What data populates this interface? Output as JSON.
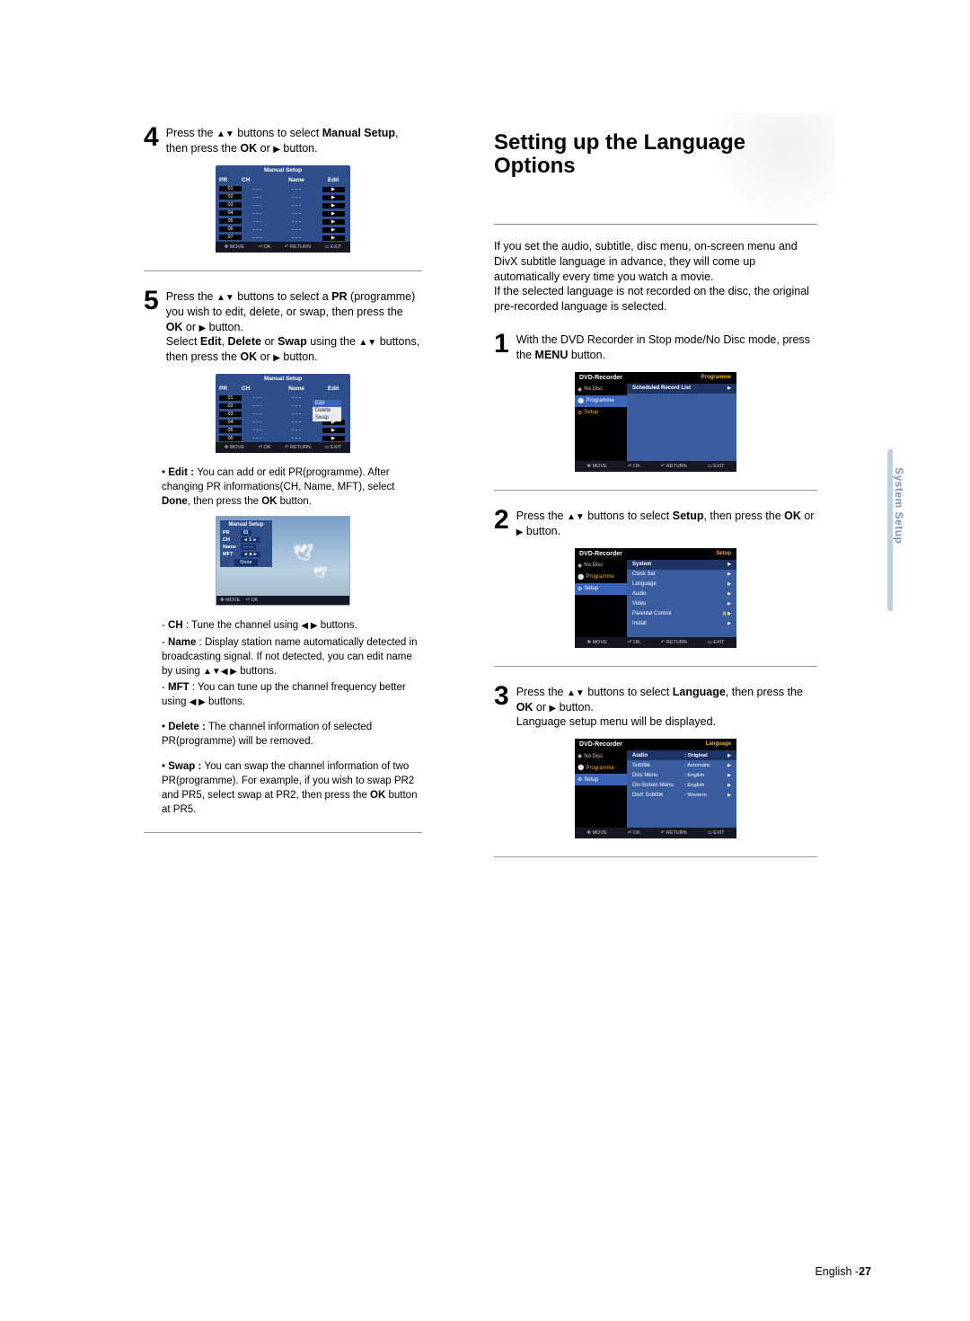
{
  "left": {
    "step4": {
      "num": "4",
      "text_a": "Press the ",
      "text_b": " buttons to select ",
      "bold_b": "Manual Setup",
      "text_c": ", then press the ",
      "bold_c": "OK",
      "text_d": " or ",
      "text_e": " button."
    },
    "osd1": {
      "title": "Manual Setup",
      "h1": "PR",
      "h2": "CH",
      "h3": "Name",
      "h4": "Edit",
      "rows": [
        "01",
        "02",
        "03",
        "04",
        "05",
        "06",
        "07"
      ],
      "cell_blank": "- - -",
      "ft_move": "MOVE",
      "ft_ok": "OK",
      "ft_return": "RETURN",
      "ft_exit": "EXIT"
    },
    "step5": {
      "num": "5",
      "l1a": "Press the ",
      "l1b": " buttons to select a ",
      "l1bold": "PR",
      "l2": "(programme) you wish to edit, delete, or swap, then press the ",
      "l2bold": "OK",
      "l2b": " or ",
      "l2c": " button.",
      "l3a": "Select ",
      "l3bold1": "Edit",
      "l3c": ", ",
      "l3bold2": "Delete",
      "l3d": " or ",
      "l3bold3": "Swap",
      "l3e": " using the ",
      "l4a": "buttons, then press the ",
      "l4bold": "OK",
      "l4b": " or ",
      "l4c": " button."
    },
    "osd2": {
      "title": "Manual Setup",
      "popup_edit": "Edit",
      "popup_delete": "Delete",
      "popup_swap": "Swap"
    },
    "edit_block": {
      "b": "Edit : ",
      "t": "You can add or edit PR(programme). After changing PR informations(CH, Name, MFT), select ",
      "done": "Done",
      "t2": ", then press the ",
      "ok": "OK",
      "t3": " button."
    },
    "scene": {
      "title": "Manual Setup",
      "r_pr": "PR",
      "r_pr_v": "01",
      "r_ch": "CH",
      "r_ch_v": "◄ 1 ►",
      "r_name": "Name",
      "r_name_v": "- - - -",
      "r_mft": "MFT",
      "r_mft_v": "◄ ■ ►",
      "done": "Done",
      "ft_move": "MOVE",
      "ft_ok": "OK"
    },
    "notes": {
      "ch_b": "CH",
      "ch_t": " : Tune the channel using ",
      "ch_t2": " buttons.",
      "name_b": "Name",
      "name_t": " : Display station name automatically detected in broadcasting signal. If not detected, you can edit name by using ",
      "name_t2": " buttons.",
      "mft_b": "MFT",
      "mft_t": " : You can tune up the channel frequency better using ",
      "mft_t2": " buttons.",
      "del_b": "Delete : ",
      "del_t": "The channel information of selected PR(programme) will be removed.",
      "swap_b": "Swap : ",
      "swap_t": "You can swap the channel information of two PR(programme). For example, if you wish to swap PR2 and PR5,  select swap at PR2, then press the ",
      "swap_ok": "OK",
      "swap_t2": " button at PR5."
    }
  },
  "right": {
    "heading": "Setting up the Language Options",
    "intro1": "If you set the audio, subtitle, disc menu, on-screen menu and DivX subtitle language in advance, they will come up automatically every time you watch a movie.",
    "intro2": "If the selected language is not recorded on the disc, the original pre-recorded language is selected.",
    "step1": {
      "num": "1",
      "a": "With the DVD Recorder in Stop mode/No Disc mode, press the ",
      "bold": "MENU",
      "b": " button."
    },
    "osd_prog": {
      "title": "DVD-Recorder",
      "tag": "Programme",
      "nodisc": "No Disc",
      "side_prog": "Programme",
      "side_setup": "Setup",
      "item": "Scheduled Record List",
      "ft_move": "MOVE",
      "ft_ok": "OK",
      "ft_return": "RETURN",
      "ft_exit": "EXIT"
    },
    "step2": {
      "num": "2",
      "a": "Press the ",
      "b": " buttons to select ",
      "bold": "Setup",
      "c": ", then press the ",
      "bold2": "OK",
      "d": " or ",
      "e": " button."
    },
    "osd_setup": {
      "title": "DVD-Recorder",
      "tag": "Setup",
      "nodisc": "No Disc",
      "side_prog": "Programme",
      "side_setup": "Setup",
      "items": [
        "System",
        "Clock Set",
        "Language",
        "Audio",
        "Video",
        "Parental Control",
        "Install"
      ],
      "ft_move": "MOVE",
      "ft_ok": "OK",
      "ft_return": "RETURN",
      "ft_exit": "EXIT"
    },
    "step3": {
      "num": "3",
      "a": "Press the ",
      "b": " buttons to select ",
      "bold": "Language",
      "c": ", then press the ",
      "bold2": "OK",
      "d": " or ",
      "e": " button.",
      "sub": "Language setup menu will be displayed."
    },
    "osd_lang": {
      "title": "DVD-Recorder",
      "tag": "Language",
      "nodisc": "No Disc",
      "side_prog": "Programme",
      "side_setup": "Setup",
      "items": [
        {
          "k": "Audio",
          "v": ": Original"
        },
        {
          "k": "Subtitle",
          "v": ": Automatic"
        },
        {
          "k": "Disc Menu",
          "v": ": English"
        },
        {
          "k": "On-Screen Menu",
          "v": ": English"
        },
        {
          "k": "DivX Subtitle",
          "v": ": Western"
        }
      ],
      "ft_move": "MOVE",
      "ft_ok": "OK",
      "ft_return": "RETURN",
      "ft_exit": "EXIT"
    }
  },
  "side_tab": "System Setup",
  "footer_lang": "English -",
  "footer_page": "27"
}
